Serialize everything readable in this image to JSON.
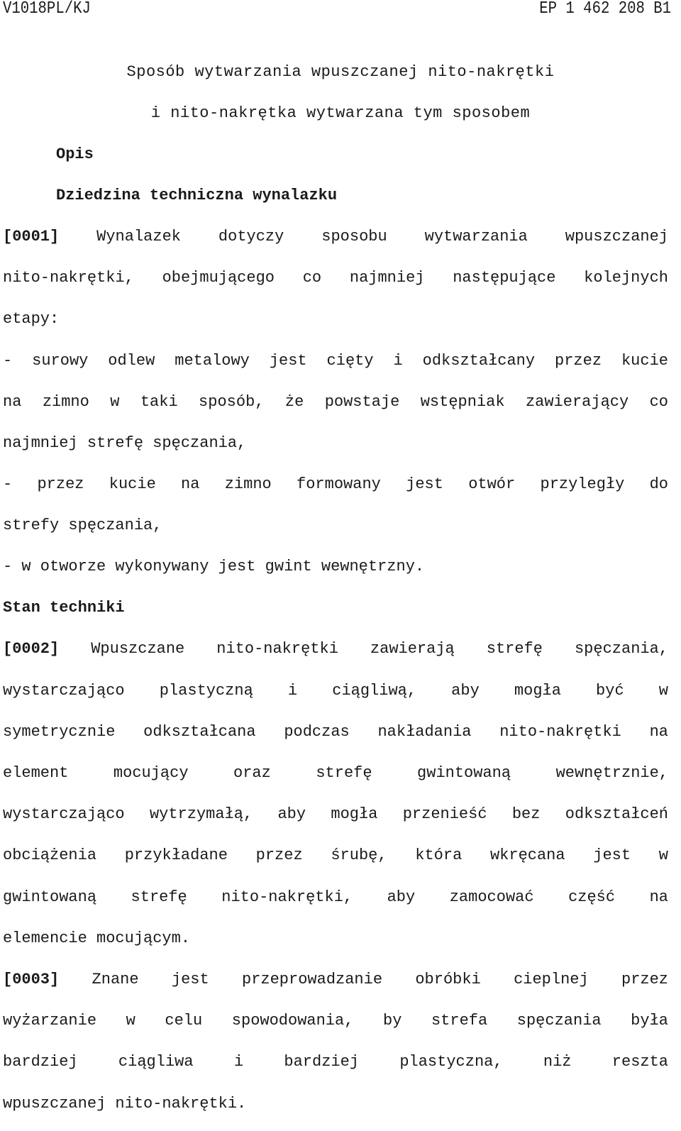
{
  "header": {
    "left": "V1018PL/KJ",
    "right": "EP 1 462 208 B1"
  },
  "title": {
    "line1": "Sposób wytwarzania wpuszczanej nito-nakrętki",
    "line2": "i nito-nakrętka wytwarzana tym sposobem"
  },
  "sections": {
    "opis": "Opis",
    "field": "Dziedzina techniczna wynalazku",
    "prior_art": "Stan techniki"
  },
  "paragraphs": {
    "p1": {
      "num": "[0001]",
      "lines": [
        "Wynalazek dotyczy sposobu wytwarzania wpuszczanej",
        "nito-nakrętki, obejmującego co najmniej następujące kolejnych",
        "etapy:",
        "- surowy odlew metalowy jest cięty i odkształcany przez kucie",
        "na zimno w taki sposób, że powstaje wstępniak zawierający co",
        "najmniej strefę spęczania,",
        "- przez kucie na zimno formowany jest otwór przyległy do",
        "strefy spęczania,",
        "- w otworze wykonywany jest gwint wewnętrzny."
      ]
    },
    "p2": {
      "num": "[0002]",
      "lines": [
        "Wpuszczane nito-nakrętki zawierają strefę spęczania,",
        "wystarczająco plastyczną i ciągliwą, aby mogła być w",
        "symetrycznie odkształcana podczas nakładania nito-nakrętki na",
        "element mocujący oraz strefę gwintowaną wewnętrznie,",
        "wystarczająco wytrzymałą, aby mogła przenieść bez odkształceń",
        "obciążenia przykładane przez śrubę, która wkręcana jest w",
        "gwintowaną strefę nito-nakrętki, aby zamocować część na",
        "elemencie mocującym."
      ]
    },
    "p3": {
      "num": "[0003]",
      "lines": [
        "Znane jest przeprowadzanie obróbki cieplnej przez",
        "wyżarzanie w celu spowodowania, by strefa spęczania była",
        "bardziej ciągliwa i bardziej plastyczna, niż reszta",
        "wpuszczanej nito-nakrętki."
      ]
    }
  }
}
